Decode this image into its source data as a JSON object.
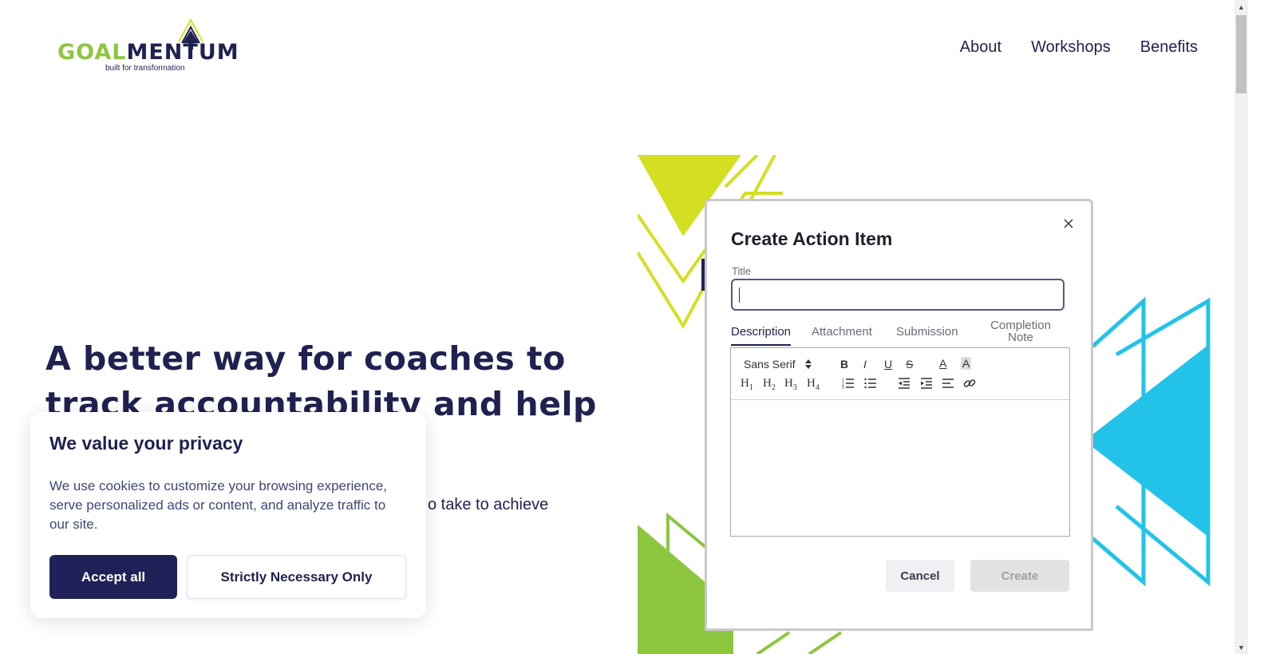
{
  "header": {
    "logo": {
      "word_green": "GOAL",
      "word_dark": "MENTUM",
      "tagline": "built for transformation"
    },
    "nav": [
      "About",
      "Workshops",
      "Benefits"
    ]
  },
  "hero": {
    "title": "A better way for coaches to track accountability and help",
    "subtitle_visible": "o take to achieve"
  },
  "modal": {
    "title": "Create Action Item",
    "title_label": "Title",
    "title_value": "",
    "tabs": [
      "Description",
      "Attachment",
      "Submission",
      "Completion Note"
    ],
    "active_tab": "Description",
    "editor": {
      "font": "Sans Serif",
      "toolbar": [
        "bold",
        "italic",
        "underline",
        "strike",
        "text-color",
        "background-color",
        "h1",
        "h2",
        "h3",
        "h4",
        "ordered-list",
        "bullet-list",
        "outdent",
        "indent",
        "align",
        "link"
      ]
    },
    "cancel_label": "Cancel",
    "create_label": "Create"
  },
  "cookie": {
    "title": "We value your privacy",
    "body": "We use cookies to customize your browsing experience, serve personalized ads or content, and analyze traffic to our site.",
    "accept_label": "Accept all",
    "necessary_label": "Strictly Necessary Only"
  },
  "colors": {
    "navy": "#1f2150",
    "logo_green": "#8dc63f",
    "lime": "#d4df22",
    "cyan": "#23c3e9",
    "green": "#8dc63f"
  }
}
